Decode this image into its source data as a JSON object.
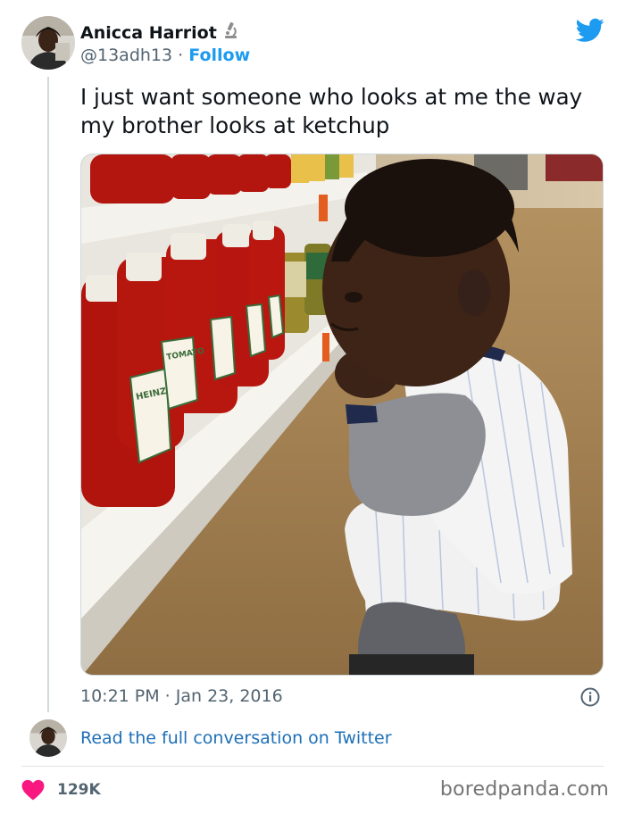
{
  "tweet": {
    "author_name": "Anicca Harriot",
    "author_handle": "@13adh13",
    "separator": "·",
    "follow_label": "Follow",
    "text": "I just want someone who looks at me the way my brother looks at ketchup",
    "timestamp": "10:21 PM · Jan 23, 2016",
    "read_conversation_label": "Read the full conversation on Twitter",
    "likes_count": "129K"
  },
  "icons": {
    "verified_badge": "microscope-icon",
    "platform": "twitter-bird-icon",
    "info": "info-icon",
    "like": "heart-icon"
  },
  "watermark": "boredpanda.com",
  "colors": {
    "accent": "#1d9bf0",
    "link": "#1d6fb8",
    "heart": "#f91880",
    "secondary_text": "#536471"
  }
}
